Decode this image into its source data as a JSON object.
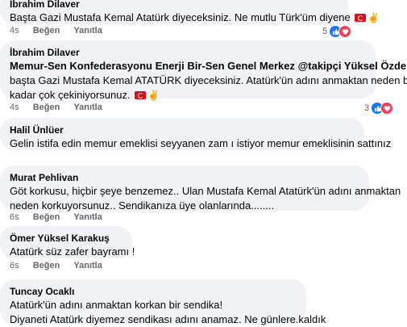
{
  "comments": [
    {
      "name": "İbrahim Dilaver",
      "lines": [
        "Başta Gazi Mustafa Kemal Atatürk diyeceksiniz. Ne mutlu Türk'üm diyene"
      ],
      "time": "4s",
      "like": "Beğen",
      "reply": "Yanıtla",
      "reaction_count": "5"
    },
    {
      "name": "İbrahim Dilaver",
      "lines": [
        "Memur-Sen Konfederasyonu Enerji Bir-Sen Genel Merkez @takipçi Yüksel Özdemir",
        "başta Gazi Mustafa Kemal ATATÜRK diyeceksiniz. Atatürk'ün adını anmaktan neden bu",
        "kadar çok çekiniyorsunuz."
      ],
      "time": "4s",
      "like": "Beğen",
      "reply": "Yanıtla",
      "reaction_count": "3"
    },
    {
      "name": "Halil Ünlüer",
      "lines": [
        "Gelin istifa edin memur emeklisi seyyanen zam ı istiyor memur emeklisinin sattınız"
      ],
      "time": "",
      "like": "",
      "reply": ""
    },
    {
      "name": "Murat Pehlivan",
      "lines": [
        "Göt korkusu, hiçbir şeye benzemez.. Ulan Mustafa Kemal Atatürk'ün adını anmaktan",
        "neden korkuyorsunuz.. Sendikanıza üye olanlarında........"
      ],
      "time": "6s",
      "like": "Beğen",
      "reply": "Yanıtla"
    },
    {
      "name": "Ömer Yüksel Karakuş",
      "lines": [
        "Atatürk süz zafer bayramı !"
      ],
      "time": "6s",
      "like": "Beğen",
      "reply": "Yanıtla"
    },
    {
      "name": "Tuncay Ocaklı",
      "lines": [
        "Atatürk'ün adını anmaktan korkan bir sendika!",
        "Diyaneti Atatürk diyemez sendikası adını anamaz. Ne günlere.kaldık"
      ]
    }
  ],
  "colors": {
    "bubble": "#f0f2f5",
    "like_blue": "#1877f2",
    "love_red": "#f33e58",
    "meta_gray": "#65676b"
  }
}
